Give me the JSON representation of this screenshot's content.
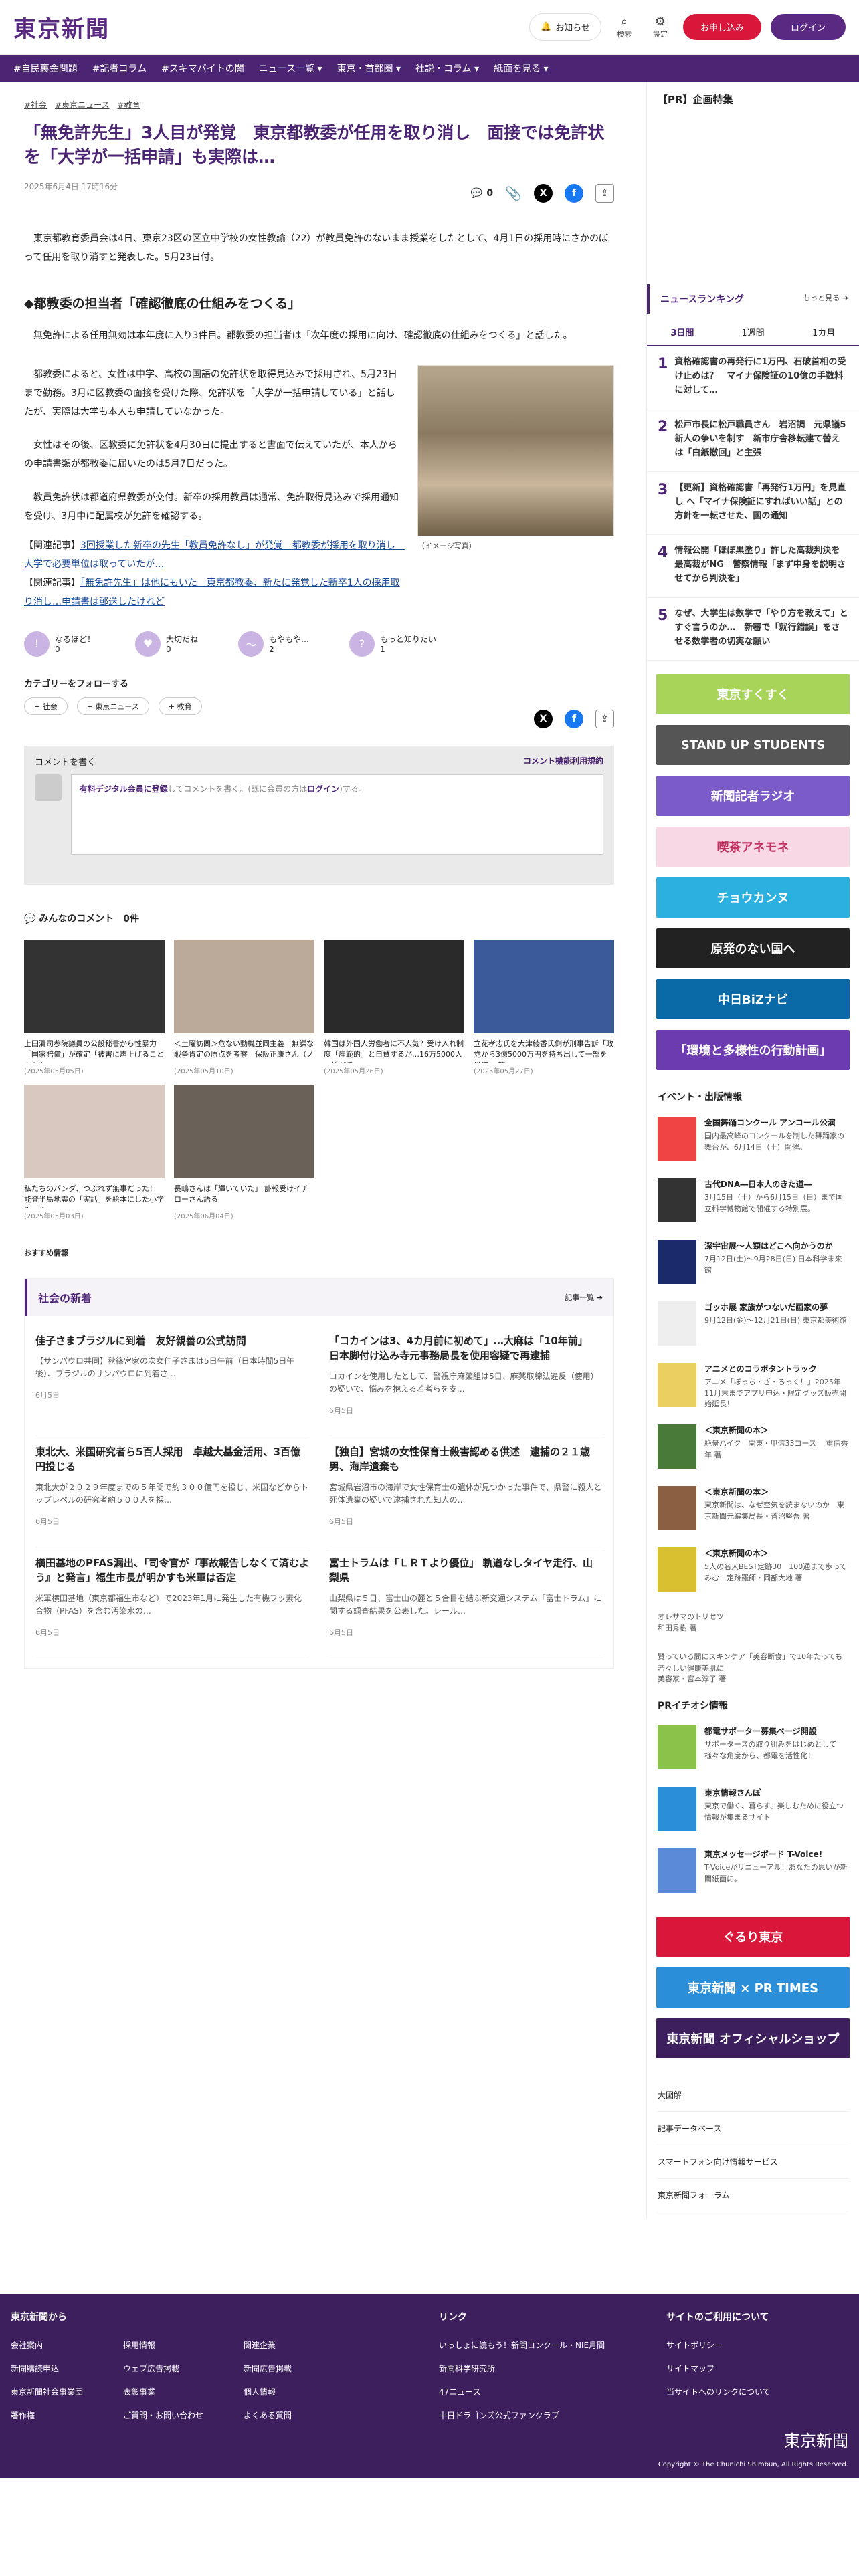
{
  "header": {
    "logo": "東京新聞",
    "notify": "お知らせ",
    "search": "検索",
    "settings": "設定",
    "subscribe": "お申し込み",
    "login": "ログイン"
  },
  "nav": [
    "#自民裏金問題",
    "#記者コラム",
    "#スキマバイトの闇",
    "ニュース一覧 ▾",
    "東京・首都圏 ▾",
    "社説・コラム ▾",
    "紙面を見る ▾"
  ],
  "article": {
    "tags": [
      "#社会",
      "#東京ニュース",
      "#教育"
    ],
    "title": "「無免許先生」3人目が発覚　東京都教委が任用を取り消し　面接では免許状を「大学が一括申請」も実際は…",
    "date": "2025年6月4日 17時16分",
    "comments_count": "0",
    "p1": "東京都教育委員会は4日、東京23区の区立中学校の女性教諭（22）が教員免許のないまま授業をしたとして、4月1日の採用時にさかのぼって任用を取り消すと発表した。5月23日付。",
    "h2": "◆都教委の担当者「確認徹底の仕組みをつくる」",
    "p2": "無免許による任用無効は本年度に入り3件目。都教委の担当者は「次年度の採用に向け、確認徹底の仕組みをつくる」と話した。",
    "p3": "都教委によると、女性は中学、高校の国語の免許状を取得見込みで採用され、5月23日まで勤務。3月に区教委の面接を受けた際、免許状を「大学が一括申請している」と話したが、実際は大学も本人も申請していなかった。",
    "p4": "女性はその後、区教委に免許状を4月30日に提出すると書面で伝えていたが、本人からの申請書類が都教委に届いたのは5月7日だった。",
    "p5": "教員免許状は都道府県教委が交付。新卒の採用教員は通常、免許取得見込みで採用通知を受け、3月中に配属校が免許を確認する。",
    "caption": "（イメージ写真）",
    "rel1_prefix": "【関連記事】",
    "rel1": "3回授業した新卒の先生「教員免許なし」が発覚　都教委が採用を取り消し　大学で必要単位は取っていたが…",
    "rel2_prefix": "【関連記事】",
    "rel2": "「無免許先生」は他にもいた　東京都教委、新たに発覚した新卒1人の採用取り消し…申請書は郵送したけれど"
  },
  "reactions": [
    {
      "icon": "!",
      "label": "なるほど！",
      "count": "0"
    },
    {
      "icon": "♥",
      "label": "大切だね",
      "count": "0"
    },
    {
      "icon": "～",
      "label": "もやもや…",
      "count": "2"
    },
    {
      "icon": "?",
      "label": "もっと知りたい",
      "count": "1"
    }
  ],
  "category_follow": "カテゴリーをフォローする",
  "categories": [
    "+ 社会",
    "+ 東京ニュース",
    "+ 教育"
  ],
  "comment_box": {
    "head": "コメントを書く",
    "terms": "コメント機能利用規約",
    "pre": "有料デジタル会員に登録",
    "mid": "してコメントを書く。(既に会員の方は",
    "login": "ログイン",
    "post": ")する。"
  },
  "all_comments": "みんなのコメント　0件",
  "cards": [
    {
      "t": "上田清司参院議員の公設秘書から性暴力「国家賠償」が確定「被害に声上げることからも…",
      "d": "(2025年05月05日)",
      "c": "#333"
    },
    {
      "t": "＜土曜訪問＞危ない動機並岡主義　無謀な戦争肯定の原点を考察　保阪正康さん（ノンフィ…",
      "d": "(2025年05月10日)",
      "c": "#bba999"
    },
    {
      "t": "韓国は外国人労働者に不人気？受け入れ制度「雇範的」と自賛するが…16万5000人の枠が手…",
      "d": "(2025年05月26日)",
      "c": "#2a2a2a"
    },
    {
      "t": "立花孝志氏を大津綾香氏側が刑事告訴「政党から3億5000万円を持ち出して一部を横領」 警…",
      "d": "(2025年05月27日)",
      "c": "#3a5a9a"
    },
    {
      "t": "私たちのパンダ、つぶれず無事だった！　能登半島地震の「実話」を絵本にした小学生　作…",
      "d": "(2025年05月03日)",
      "c": "#d8c8c0"
    },
    {
      "t": "長嶋さんは「輝いていた」 訃報受けイチローさん語る",
      "d": "(2025年06月04日)",
      "c": "#6a6258"
    }
  ],
  "osusume": "おすすめ情報",
  "social": {
    "title": "社会の新着",
    "more": "記事一覧 ➔",
    "items": [
      {
        "t": "佳子さまブラジルに到着　友好親善の公式訪問",
        "b": "【サンパウロ共同】秋篠宮家の次女佳子さまは5日午前（日本時間5日午後）、ブラジルのサンパウロに到着さ…",
        "d": "6月5日"
      },
      {
        "t": "「コカインは3、4カ月前に初めて」…大麻は「10年前」　日本脚付け込み寺元事務局長を使用容疑で再逮捕",
        "b": "コカインを使用したとして、警視庁麻薬組は5日、麻薬取締法違反（使用）の疑いで、悩みを抱える若者らを支…",
        "d": "6月5日"
      },
      {
        "t": "東北大、米国研究者ら5百人採用　卓越大基金活用、3百億円投じる",
        "b": "東北大が２０２９年度までの５年間で約３００億円を投じ、米国などからトップレベルの研究者約５００人を採…",
        "d": "6月5日"
      },
      {
        "t": "【独自】宮城の女性保育士殺害認める供述　逮捕の２１歳男、海岸遺棄も",
        "b": "宮城県岩沼市の海岸で女性保育士の遺体が見つかった事件で、県警に殺人と死体遺棄の疑いで逮捕された知人の…",
        "d": "6月5日"
      },
      {
        "t": "横田基地のPFAS漏出、「司令官が『事故報告しなくて済むよう』と発言」福生市長が明かすも米軍は否定",
        "b": "米軍横田基地（東京都福生市など）で2023年1月に発生した有機フッ素化合物（PFAS）を含む汚染水の…",
        "d": "6月5日"
      },
      {
        "t": "富士トラムは「ＬＲＴより優位」 軌道なしタイヤ走行、山梨県",
        "b": "山梨県は５日、富士山の麓と５合目を結ぶ新交通システム「富士トラム」に関する調査結果を公表した。レール…",
        "d": "6月5日"
      }
    ]
  },
  "side": {
    "pr_title": "【PR】企画特集",
    "rank_title": "ニュースランキング",
    "rank_more": "もっと見る ➔",
    "tabs": [
      "3日間",
      "1週間",
      "1カ月"
    ],
    "ranking": [
      "資格確認書の再発行に1万円、石破首相の受け止めは？　マイナ保険証の10億の手数料に対して…",
      "松戸市長に松戸職員さん　岩沼調　元県議5新人の争いを制す　新市庁舎移転建て替えは「白紙撤回」と主張",
      "【更新】資格確認書「再発行1万円」を見直し へ「マイナ保険証にすればいい話」との方針を一転させた、国の通知",
      "情報公開「ほぼ黒塗り」許した高裁判決を最高裁がNG　警察情報「まず中身を説明させてから判決を」",
      "なぜ、大学生は数学で「やり方を教えて」とすぐ言うのか…　新審で「就行錯誤」をさせる数学者の切実な願い"
    ],
    "banners": [
      {
        "t": "東京すくすく",
        "bg": "#a8d45a"
      },
      {
        "t": "STAND UP STUDENTS",
        "bg": "#555"
      },
      {
        "t": "新聞記者ラジオ",
        "bg": "#7b5bc8"
      },
      {
        "t": "喫茶アネモネ",
        "bg": "#f7d8e4"
      },
      {
        "t": "チョウカンヌ",
        "bg": "#2bb0e0"
      },
      {
        "t": "原発のない国へ",
        "bg": "#222"
      },
      {
        "t": "中日BiZナビ",
        "bg": "#0a6aa8"
      },
      {
        "t": "「環境と多様性の行動計画」",
        "bg": "#6d3bb0"
      }
    ],
    "events_title": "イベント・出版情報",
    "events": [
      {
        "t": "全国舞踊コンクール アンコール公演",
        "b": "国内最高峰のコンクールを制した舞踊家の舞台が、6月14日（土）開催。",
        "c": "#e44"
      },
      {
        "t": "古代DNA―日本人のきた道―",
        "b": "3月15日（土）から6月15日（日）まで国立科学博物館で開催する特別展。",
        "c": "#333"
      },
      {
        "t": "深宇宙展〜人類はどこへ向かうのか",
        "b": "7月12日(土)〜9月28日(日) 日本科学未来館",
        "c": "#1b2a6b"
      },
      {
        "t": "ゴッホ展 家族がつないだ画家の夢",
        "b": "9月12日(金)〜12月21日(日) 東京都美術館",
        "c": "#eee"
      },
      {
        "t": "アニメとのコラボタントラック",
        "b": "アニメ「ぼっち・ざ・ろっく！」2025年11月末までアプリ申込・限定グッズ販売開始延長！",
        "c": "#e9d060"
      },
      {
        "t": "＜東京新聞の本＞",
        "b": "絶景ハイク　関東・甲信33コース　 重信秀年 著",
        "c": "#4a7a3a"
      },
      {
        "t": "＜東京新聞の本＞",
        "b": "東京新聞は、なぜ空気を読まないのか　東京新聞元編集局長・菅沼堅吾 著",
        "c": "#8a6040"
      },
      {
        "t": "＜東京新聞の本＞",
        "b": "5人の名人BEST定跡30　100通まで歩ってみむ　定跡羅師・岡部大地 著",
        "c": "#d8c030"
      }
    ],
    "osera": "オレサマのトリセツ\n和田秀樹 著",
    "sukima": "賢っている間にスキンケア「美容断食」で10年たっても若々しい健康美肌に\n美容家・宮本淳子 著",
    "pr_info": "PRイチオシ情報",
    "prs": [
      {
        "t": "都電サポーター募集ページ開設",
        "b": "サポーターズの取り組みをはじめとして様々な角度から、都電を活性化！"
      },
      {
        "t": "東京情報さんぽ",
        "b": "東京で働く、暮らす、楽しむために役立つ情報が集まるサイト"
      },
      {
        "t": "東京メッセージボード T-Voice!",
        "b": "T-Voiceがリニューアル！あなたの思いが新聞紙面に。"
      }
    ],
    "pr_banners": [
      "ぐるり東京",
      "東京新聞 × PR TIMES",
      "東京新聞 オフィシャルショップ"
    ],
    "links": [
      "大図解",
      "記事データベース",
      "スマートフォン向け情報サービス",
      "東京新聞フォーラム"
    ]
  },
  "footer": {
    "from": "東京新聞から",
    "c1": [
      "会社案内",
      "新聞購読申込",
      "東京新聞社会事業団",
      "著作権"
    ],
    "c2": [
      "採用情報",
      "ウェブ広告掲載",
      "表彰事業",
      "ご質問・お問い合わせ"
    ],
    "c3": [
      "関連企業",
      "新聞広告掲載",
      "個人情報",
      "よくある質問"
    ],
    "link": "リンク",
    "c4": [
      "いっしょに読もう！新聞コンクール・NIE月間",
      "新聞科学研究所",
      "47ニュース",
      "中日ドラゴンズ公式ファンクラブ"
    ],
    "use": "サイトのご利用について",
    "c5": [
      "サイトポリシー",
      "サイトマップ",
      "当サイトへのリンクについて"
    ],
    "logo": "東京新聞",
    "copy": "Copyright © The Chunichi Shimbun, All Rights Reserved."
  }
}
